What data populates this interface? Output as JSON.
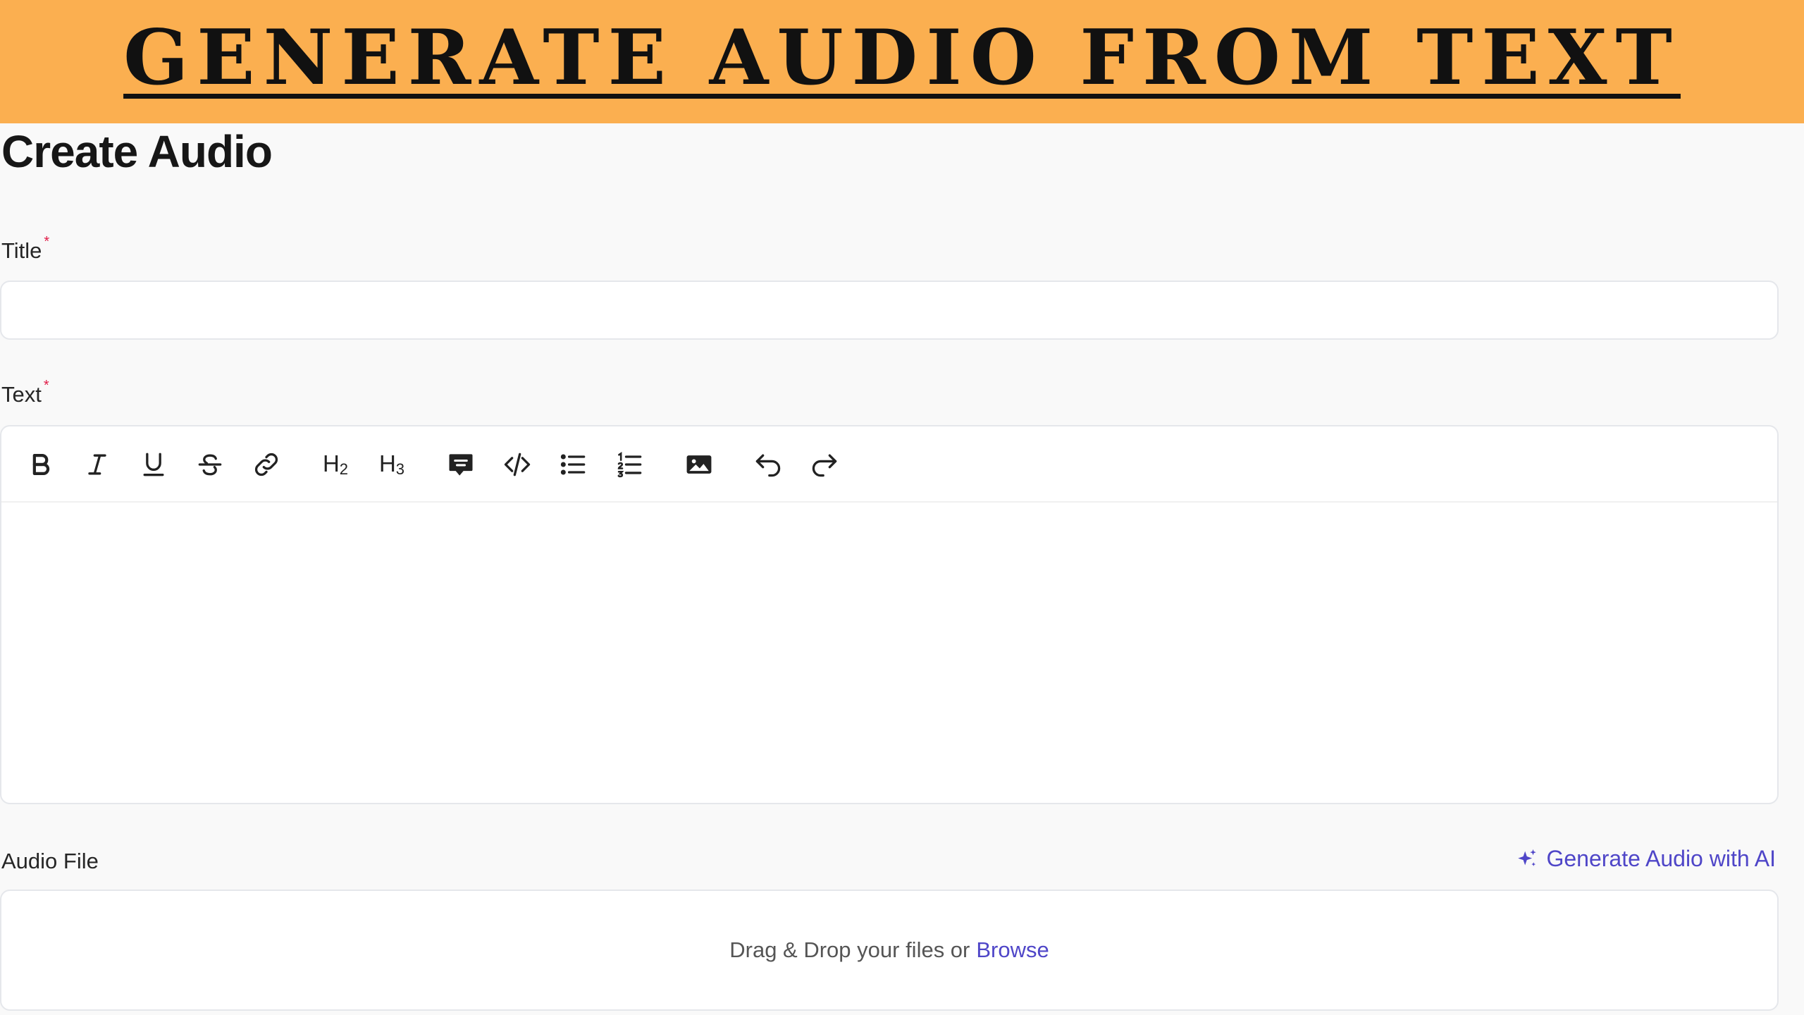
{
  "banner": {
    "title": "GENERATE AUDIO FROM TEXT"
  },
  "page": {
    "title": "Create Audio"
  },
  "form": {
    "title_label": "Title",
    "title_value": "",
    "title_placeholder": "",
    "text_label": "Text",
    "required_marker": "*",
    "audio_label": "Audio File",
    "ai_button_label": "Generate Audio with AI",
    "dropzone_text": "Drag & Drop your files or",
    "browse_label": "Browse"
  },
  "toolbar": {
    "h2_label": "H",
    "h2_sub": "2",
    "h3_label": "H",
    "h3_sub": "3",
    "buttons": [
      "bold-icon",
      "italic-icon",
      "underline-icon",
      "strikethrough-icon",
      "link-icon",
      "heading-2",
      "heading-3",
      "comment-icon",
      "code-icon",
      "bullet-list-icon",
      "numbered-list-icon",
      "image-icon",
      "undo-icon",
      "redo-icon"
    ]
  },
  "colors": {
    "banner": "#fbaf50",
    "accent": "#4f46c8",
    "required": "#e11d48"
  }
}
